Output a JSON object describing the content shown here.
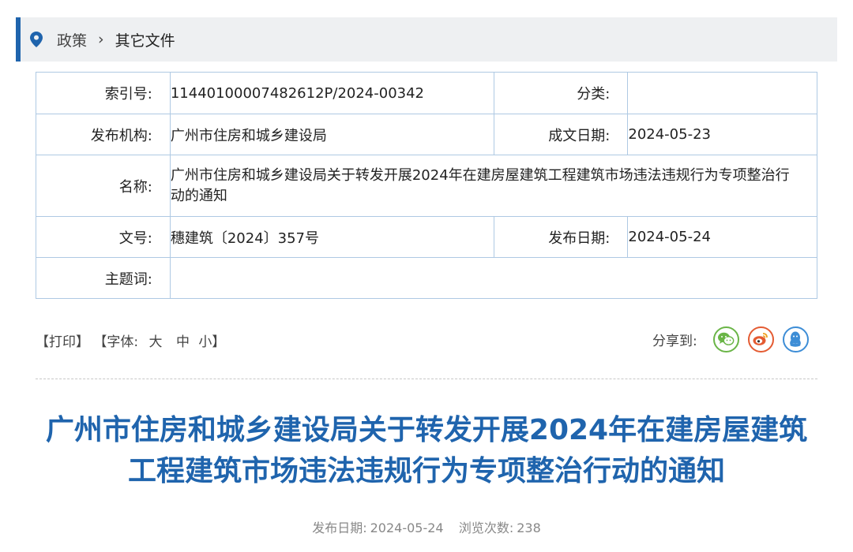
{
  "breadcrumb": {
    "items": [
      "政策",
      "其它文件"
    ],
    "separator": "›",
    "accent_color": "#1f64ad"
  },
  "meta": {
    "index_label": "索引号:",
    "index_value": "11440100007482612P/2024-00342",
    "category_label": "分类:",
    "category_value": "",
    "publisher_label": "发布机构:",
    "publisher_value": "广州市住房和城乡建设局",
    "written_date_label": "成文日期:",
    "written_date_value": "2024-05-23",
    "name_label": "名称:",
    "name_value": "广州市住房和城乡建设局关于转发开展2024年在建房屋建筑工程建筑市场违法违规行为专项整治行动的通知",
    "doc_no_label": "文号:",
    "doc_no_value": "穗建筑〔2024〕357号",
    "release_date_label": "发布日期:",
    "release_date_value": "2024-05-24",
    "subject_label": "主题词:",
    "subject_value": ""
  },
  "tools": {
    "print": "【打印】",
    "font_open": "【字体:",
    "font_large": "大",
    "font_medium": "中",
    "font_small": "小】"
  },
  "share": {
    "label": "分享到:",
    "icons": [
      "wechat-icon",
      "weibo-icon",
      "qq-icon"
    ]
  },
  "article": {
    "title": "广州市住房和城乡建设局关于转发开展2024年在建房屋建筑工程建筑市场违法违规行为专项整治行动的通知",
    "title_color": "#1f64ad",
    "pub_label": "发布日期:",
    "pub_date": "2024-05-24",
    "views_label": "浏览次数:",
    "views": "238"
  }
}
